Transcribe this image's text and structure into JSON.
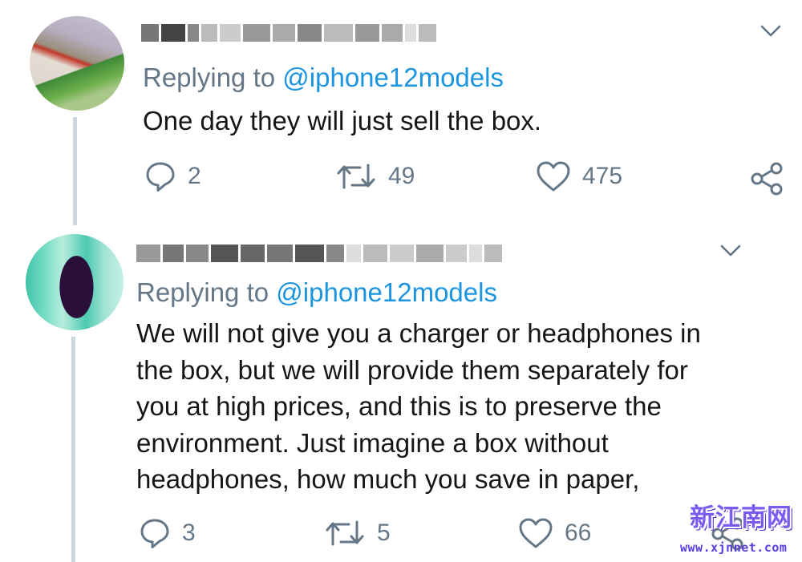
{
  "tweets": [
    {
      "replying_prefix": "Replying to",
      "replying_handle": "@iphone12models",
      "text": "One day they will just sell the box.",
      "replies": "2",
      "retweets": "49",
      "likes": "475"
    },
    {
      "replying_prefix": "Replying to",
      "replying_handle": "@iphone12models",
      "text_lines": [
        "We will not give you a charger or headphones in",
        "the box, but we will provide them separately for",
        "you at high prices, and this is to preserve the",
        "environment. Just imagine a box without",
        "headphones, how much you save in paper,"
      ],
      "replies": "3",
      "retweets": "5",
      "likes": "66"
    }
  ],
  "icons": {
    "reply": "speech-bubble-icon",
    "retweet": "retweet-arrows-icon",
    "like": "heart-icon",
    "share": "share-icon",
    "menu": "chevron-down-icon"
  },
  "colors": {
    "text": "#14171a",
    "secondary": "#657786",
    "link": "#1b95e0",
    "thread_line": "#ccd6dd"
  },
  "watermark": {
    "logo_text": "新江南网",
    "url": "www.xjnnet.com"
  }
}
